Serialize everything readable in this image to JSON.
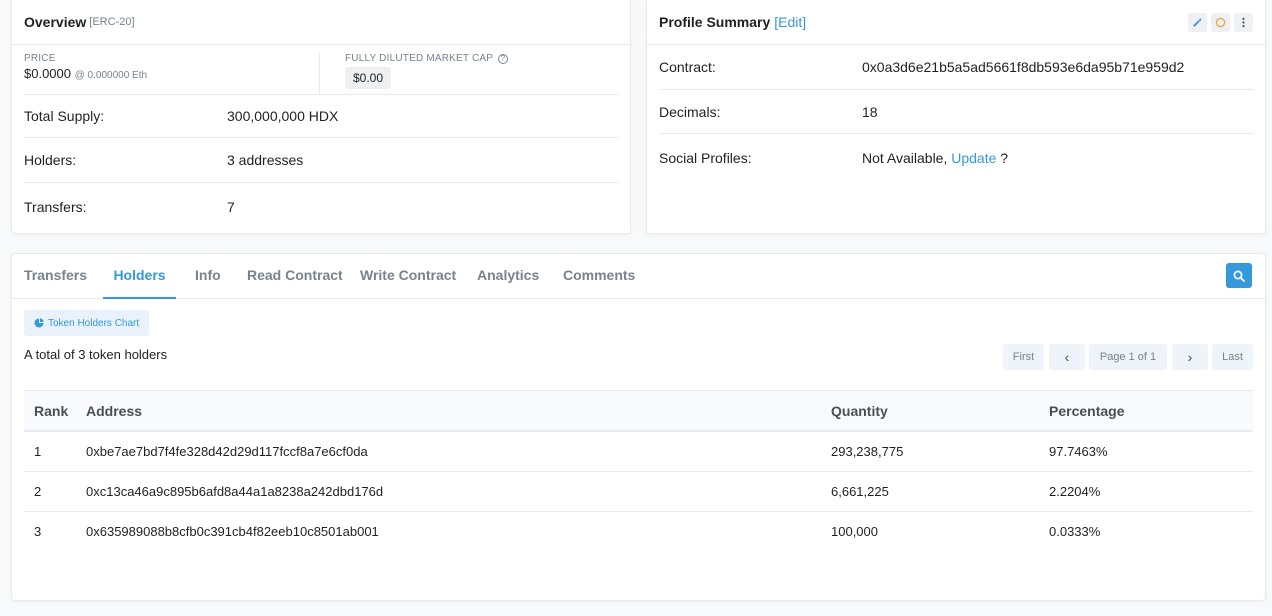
{
  "overview": {
    "title": "Overview",
    "subtitle": "[ERC-20]",
    "price_label": "PRICE",
    "price_value": "$0.0000",
    "price_eth": "@ 0.000000 Eth",
    "mcap_label": "FULLY DILUTED MARKET CAP",
    "mcap_value": "$0.00",
    "rows": [
      {
        "label": "Total Supply:",
        "value": "300,000,000 HDX"
      },
      {
        "label": "Holders:",
        "value": "3 addresses"
      },
      {
        "label": "Transfers:",
        "value": "7"
      }
    ]
  },
  "profile": {
    "title": "Profile Summary",
    "edit_label": "[Edit]",
    "contract_label": "Contract:",
    "contract_value": "0x0a3d6e21b5a5ad5661f8db593e6da95b71e959d2",
    "decimals_label": "Decimals:",
    "decimals_value": "18",
    "social_label": "Social Profiles:",
    "social_value": "Not Available,",
    "social_link": "Update",
    "social_suffix": "?",
    "icons": [
      "magic-wand-icon",
      "circle-icon",
      "more-vertical-icon"
    ]
  },
  "tabs": [
    {
      "label": "Transfers",
      "active": false
    },
    {
      "label": "Holders",
      "active": true
    },
    {
      "label": "Info",
      "active": false
    },
    {
      "label": "Read Contract",
      "active": false
    },
    {
      "label": "Write Contract",
      "active": false
    },
    {
      "label": "Analytics",
      "active": false
    },
    {
      "label": "Comments",
      "active": false
    }
  ],
  "holders": {
    "chart_button": "Token Holders Chart",
    "total_text": "A total of 3 token holders",
    "pager": {
      "first": "First",
      "prev": "‹",
      "page": "Page 1 of 1",
      "next": "›",
      "last": "Last"
    },
    "columns": [
      "Rank",
      "Address",
      "Quantity",
      "Percentage"
    ],
    "rows": [
      {
        "rank": "1",
        "address": "0xbe7ae7bd7f4fe328d42d29d117fccf8a7e6cf0da",
        "quantity": "293,238,775",
        "percentage": "97.7463%"
      },
      {
        "rank": "2",
        "address": "0xc13ca46a9c895b6afd8a44a1a8238a242dbd176d",
        "quantity": "6,661,225",
        "percentage": "2.2204%"
      },
      {
        "rank": "3",
        "address": "0x635989088b8cfb0c391cb4f82eeb10c8501ab001",
        "quantity": "100,000",
        "percentage": "0.0333%"
      }
    ]
  },
  "colors": {
    "accent": "#3498db",
    "muted": "#77838f",
    "border": "#e7eaf3"
  }
}
